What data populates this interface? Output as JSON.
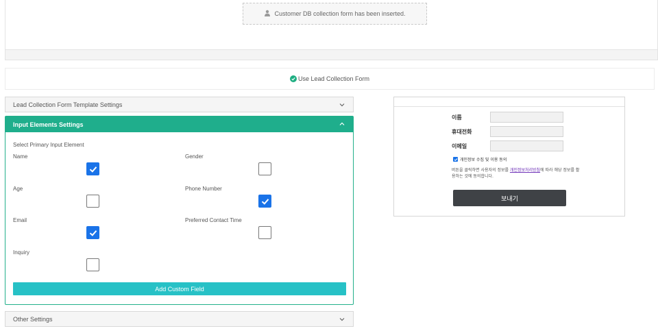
{
  "banner": {
    "inserted_text": "Customer DB collection form has been inserted.",
    "icon": "user-icon"
  },
  "use_form": {
    "label": "Use Lead Collection Form",
    "checked": true,
    "icon": "check-circle-icon"
  },
  "accordions": {
    "template_settings": {
      "label": "Lead Collection Form Template Settings",
      "expanded": false
    },
    "input_settings": {
      "label": "Input Elements Settings",
      "expanded": true
    },
    "other_settings": {
      "label": "Other Settings",
      "expanded": false
    }
  },
  "input_elements": {
    "primary_label": "Select Primary Input Element",
    "fields": [
      {
        "label": "Name",
        "checked": true
      },
      {
        "label": "Gender",
        "checked": false
      },
      {
        "label": "Age",
        "checked": false
      },
      {
        "label": "Phone Number",
        "checked": true
      },
      {
        "label": "Email",
        "checked": true
      },
      {
        "label": "Preferred Contact Time",
        "checked": false
      },
      {
        "label": "Inquiry",
        "checked": false
      }
    ],
    "add_button": "Add Custom Field"
  },
  "preview": {
    "fields": [
      {
        "label": "이름"
      },
      {
        "label": "휴대전화"
      },
      {
        "label": "이메일"
      }
    ],
    "agree_text": "개인정보 수집 및 이용 동의",
    "agree_checked": true,
    "notice_before": "버튼을 클릭하면 사용자의 정보를 ",
    "notice_link": "개인정보처리방침",
    "notice_after": "에 따라 해당 정보를 활용하는 것에 동의합니다.",
    "send_button": "보내기"
  },
  "colors": {
    "accent_green": "#1fae8c",
    "checkbox_blue": "#1a73e8",
    "add_button": "#27c1c6",
    "send_button": "#3f4246"
  }
}
